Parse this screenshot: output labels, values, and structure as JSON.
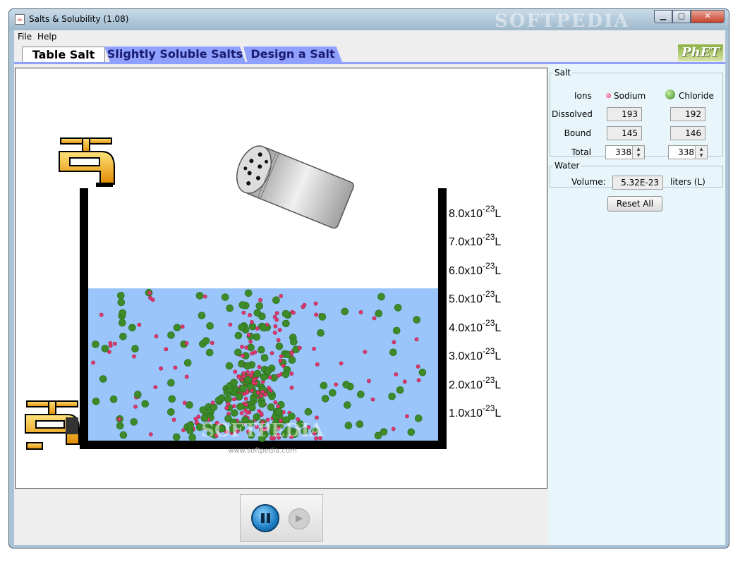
{
  "window": {
    "title": "Salts & Solubility (1.08)",
    "watermark": "SOFTPEDIA",
    "icon": "java-icon",
    "controls": {
      "minimize": "▁",
      "maximize": "▢",
      "close": "✕"
    }
  },
  "menu": [
    "File",
    "Help"
  ],
  "tabs": [
    {
      "label": "Table Salt",
      "active": true
    },
    {
      "label": "Slightly Soluble Salts",
      "active": false
    },
    {
      "label": "Design a Salt",
      "active": false
    }
  ],
  "logo": "PhET",
  "beaker": {
    "scale_marks": [
      {
        "base": "8.0x10",
        "exp": "-23",
        "unit": "L"
      },
      {
        "base": "7.0x10",
        "exp": "-23",
        "unit": "L"
      },
      {
        "base": "6.0x10",
        "exp": "-23",
        "unit": "L"
      },
      {
        "base": "5.0x10",
        "exp": "-23",
        "unit": "L"
      },
      {
        "base": "4.0x10",
        "exp": "-23",
        "unit": "L"
      },
      {
        "base": "3.0x10",
        "exp": "-23",
        "unit": "L"
      },
      {
        "base": "2.0x10",
        "exp": "-23",
        "unit": "L"
      },
      {
        "base": "1.0x10",
        "exp": "-23",
        "unit": "L"
      }
    ],
    "watermark": "SOFTPEDIA",
    "watermark_url": "www.softpedia.com",
    "colors": {
      "water": "#99c5fb",
      "sodium": "#e2376c",
      "chloride": "#3c8a28"
    }
  },
  "salt": {
    "legend": "Salt",
    "ions_label": "Ions",
    "sodium_label": "Sodium",
    "chloride_label": "Chloride",
    "dissolved_label": "Dissolved",
    "bound_label": "Bound",
    "total_label": "Total",
    "sodium": {
      "dissolved": "193",
      "bound": "145",
      "total": "338"
    },
    "chloride": {
      "dissolved": "192",
      "bound": "146",
      "total": "338"
    }
  },
  "water": {
    "legend": "Water",
    "volume_label": "Volume:",
    "volume_value": "5.32E-23",
    "unit": "liters (L)"
  },
  "reset_label": "Reset All",
  "clock": {
    "pause_icon": "pause-icon",
    "step_icon": "step-icon"
  }
}
